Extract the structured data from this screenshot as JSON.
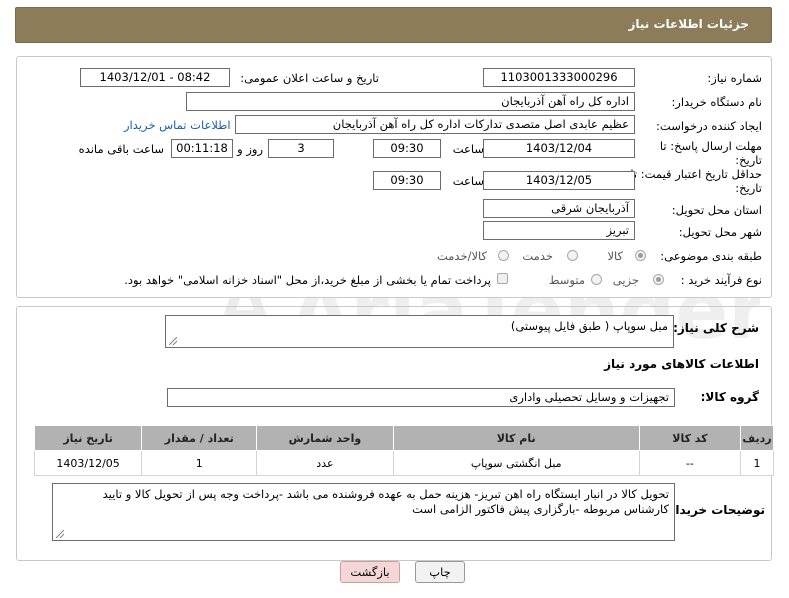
{
  "header": {
    "title": "جزئیات اطلاعات نیاز"
  },
  "form": {
    "need_number_label": "شماره نیاز:",
    "need_number_value": "1103001333000296",
    "announce_label": "تاریخ و ساعت اعلان عمومی:",
    "announce_value": "1403/12/01 - 08:42",
    "buyer_org_label": "نام دستگاه خریدار:",
    "buyer_org_value": "اداره کل راه آهن آذربایجان",
    "requester_label": "ایجاد کننده درخواست:",
    "requester_value": "عظیم عابدی اصل متصدی تدارکات اداره کل راه آهن آذربایجان",
    "contact_link": "اطلاعات تماس خریدار",
    "reply_deadline_label_1": "مهلت ارسال پاسخ: تا",
    "reply_deadline_label_2": "تاریخ:",
    "reply_date": "1403/12/04",
    "time_label": "ساعت",
    "reply_time": "09:30",
    "days_value": "3",
    "days_label": "روز و",
    "remaining_time": "00:11:18",
    "remaining_label": "ساعت باقی مانده",
    "price_validity_label_1": "حداقل تاریخ اعتبار قیمت: تا",
    "price_validity_label_2": "تاریخ:",
    "price_date": "1403/12/05",
    "price_time_label": "ساعت",
    "price_time": "09:30",
    "province_label": "استان محل تحویل:",
    "province_value": "آذربایجان شرقی",
    "city_label": "شهر محل تحویل:",
    "city_value": "تبریز",
    "category_label": "طبقه بندی موضوعی:",
    "category_options": [
      "کالا",
      "خدمت",
      "کالا/خدمت"
    ],
    "category_selected": "کالا",
    "process_label": "نوع فرآیند خرید :",
    "process_options": [
      "جزیی",
      "متوسط"
    ],
    "process_selected": "جزیی",
    "payment_note": "پرداخت تمام یا بخشی از مبلغ خرید،از محل \"اسناد خزانه اسلامی\" خواهد بود."
  },
  "details": {
    "description_label": "شرح کلی نیاز:",
    "description_value": "مبل سوپاپ ( طبق فایل پیوستی)",
    "goods_info_title": "اطلاعات کالاهای مورد نیاز",
    "goods_group_label": "گروه کالا:",
    "goods_group_value": "تجهیزات و وسایل تحصیلی واداری",
    "table": {
      "headers": [
        "ردیف",
        "کد کالا",
        "نام کالا",
        "واحد شمارش",
        "تعداد / مقدار",
        "تاریخ نیاز"
      ],
      "rows": [
        [
          "1",
          "--",
          "مبل انگشتی سوپاپ",
          "عدد",
          "1",
          "1403/12/05"
        ]
      ]
    },
    "buyer_notes_label": "توضیحات خریدار:",
    "buyer_notes_value": "تحویل کالا در انبار ایستگاه راه اهن تبریز- هزینه حمل به عهده  فروشنده می باشد -پرداخت وجه پس از تحویل کالا و تایید کارشناس مربوطه -بارگزاری پیش فاکتور الزامی است"
  },
  "buttons": {
    "print": "چاپ",
    "back": "بازگشت"
  },
  "colors": {
    "header_bg": "#8c7c5a",
    "table_header_bg": "#b2b2b2",
    "link": "#1a5fb4",
    "back_button_bg": "#f4d6d6"
  }
}
